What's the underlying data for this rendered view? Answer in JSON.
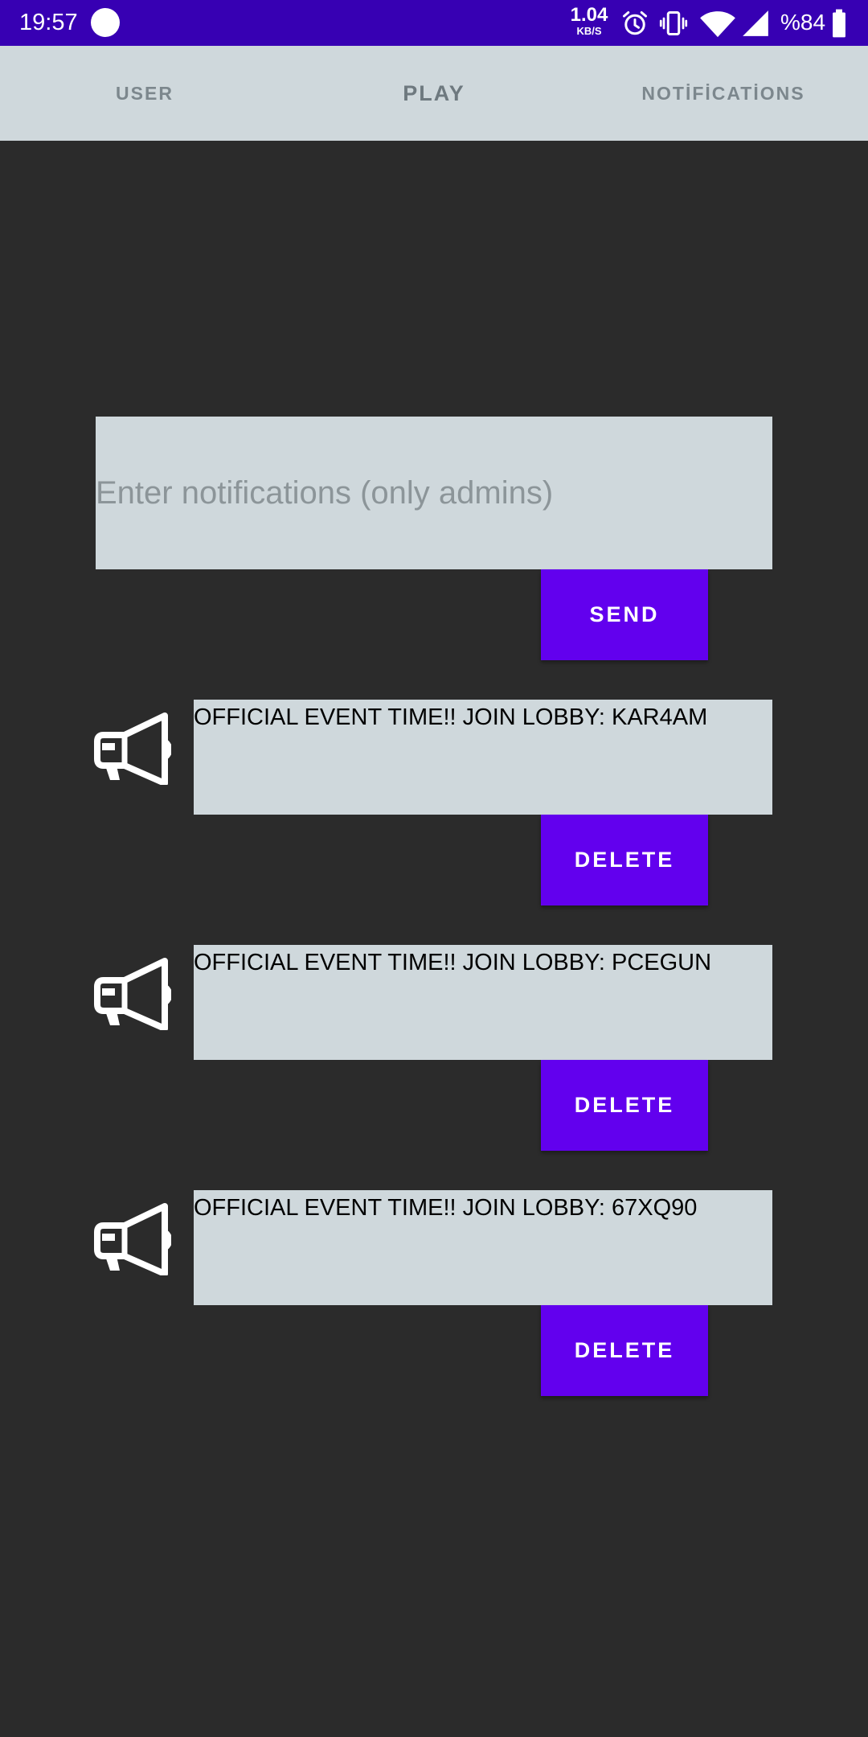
{
  "status_bar": {
    "time": "19:57",
    "speed_value": "1.04",
    "speed_unit": "KB/S",
    "battery": "%84",
    "icons": [
      "alarm-icon",
      "vibrate-icon",
      "wifi-icon",
      "signal-icon",
      "battery-icon"
    ],
    "color": "#3700b3"
  },
  "tabs": [
    {
      "label": "USER",
      "active": false
    },
    {
      "label": "PLAY",
      "active": true
    },
    {
      "label": "NOTİFİCATİONS",
      "active": false
    }
  ],
  "compose": {
    "placeholder": "Enter notifications (only admins)",
    "value": "",
    "send_label": "SEND"
  },
  "notifications": [
    {
      "text": "OFFICIAL EVENT TIME!! JOIN LOBBY: KAR4AM",
      "delete_label": "DELETE",
      "icon": "megaphone-icon"
    },
    {
      "text": "OFFICIAL EVENT TIME!! JOIN LOBBY: PCEGUN",
      "delete_label": "DELETE",
      "icon": "megaphone-icon"
    },
    {
      "text": "OFFICIAL EVENT TIME!! JOIN LOBBY: 67XQ90",
      "delete_label": "DELETE",
      "icon": "megaphone-icon"
    }
  ],
  "colors": {
    "accent": "#6200ee",
    "background": "#2b2b2b",
    "surface": "#cfd8dc"
  }
}
